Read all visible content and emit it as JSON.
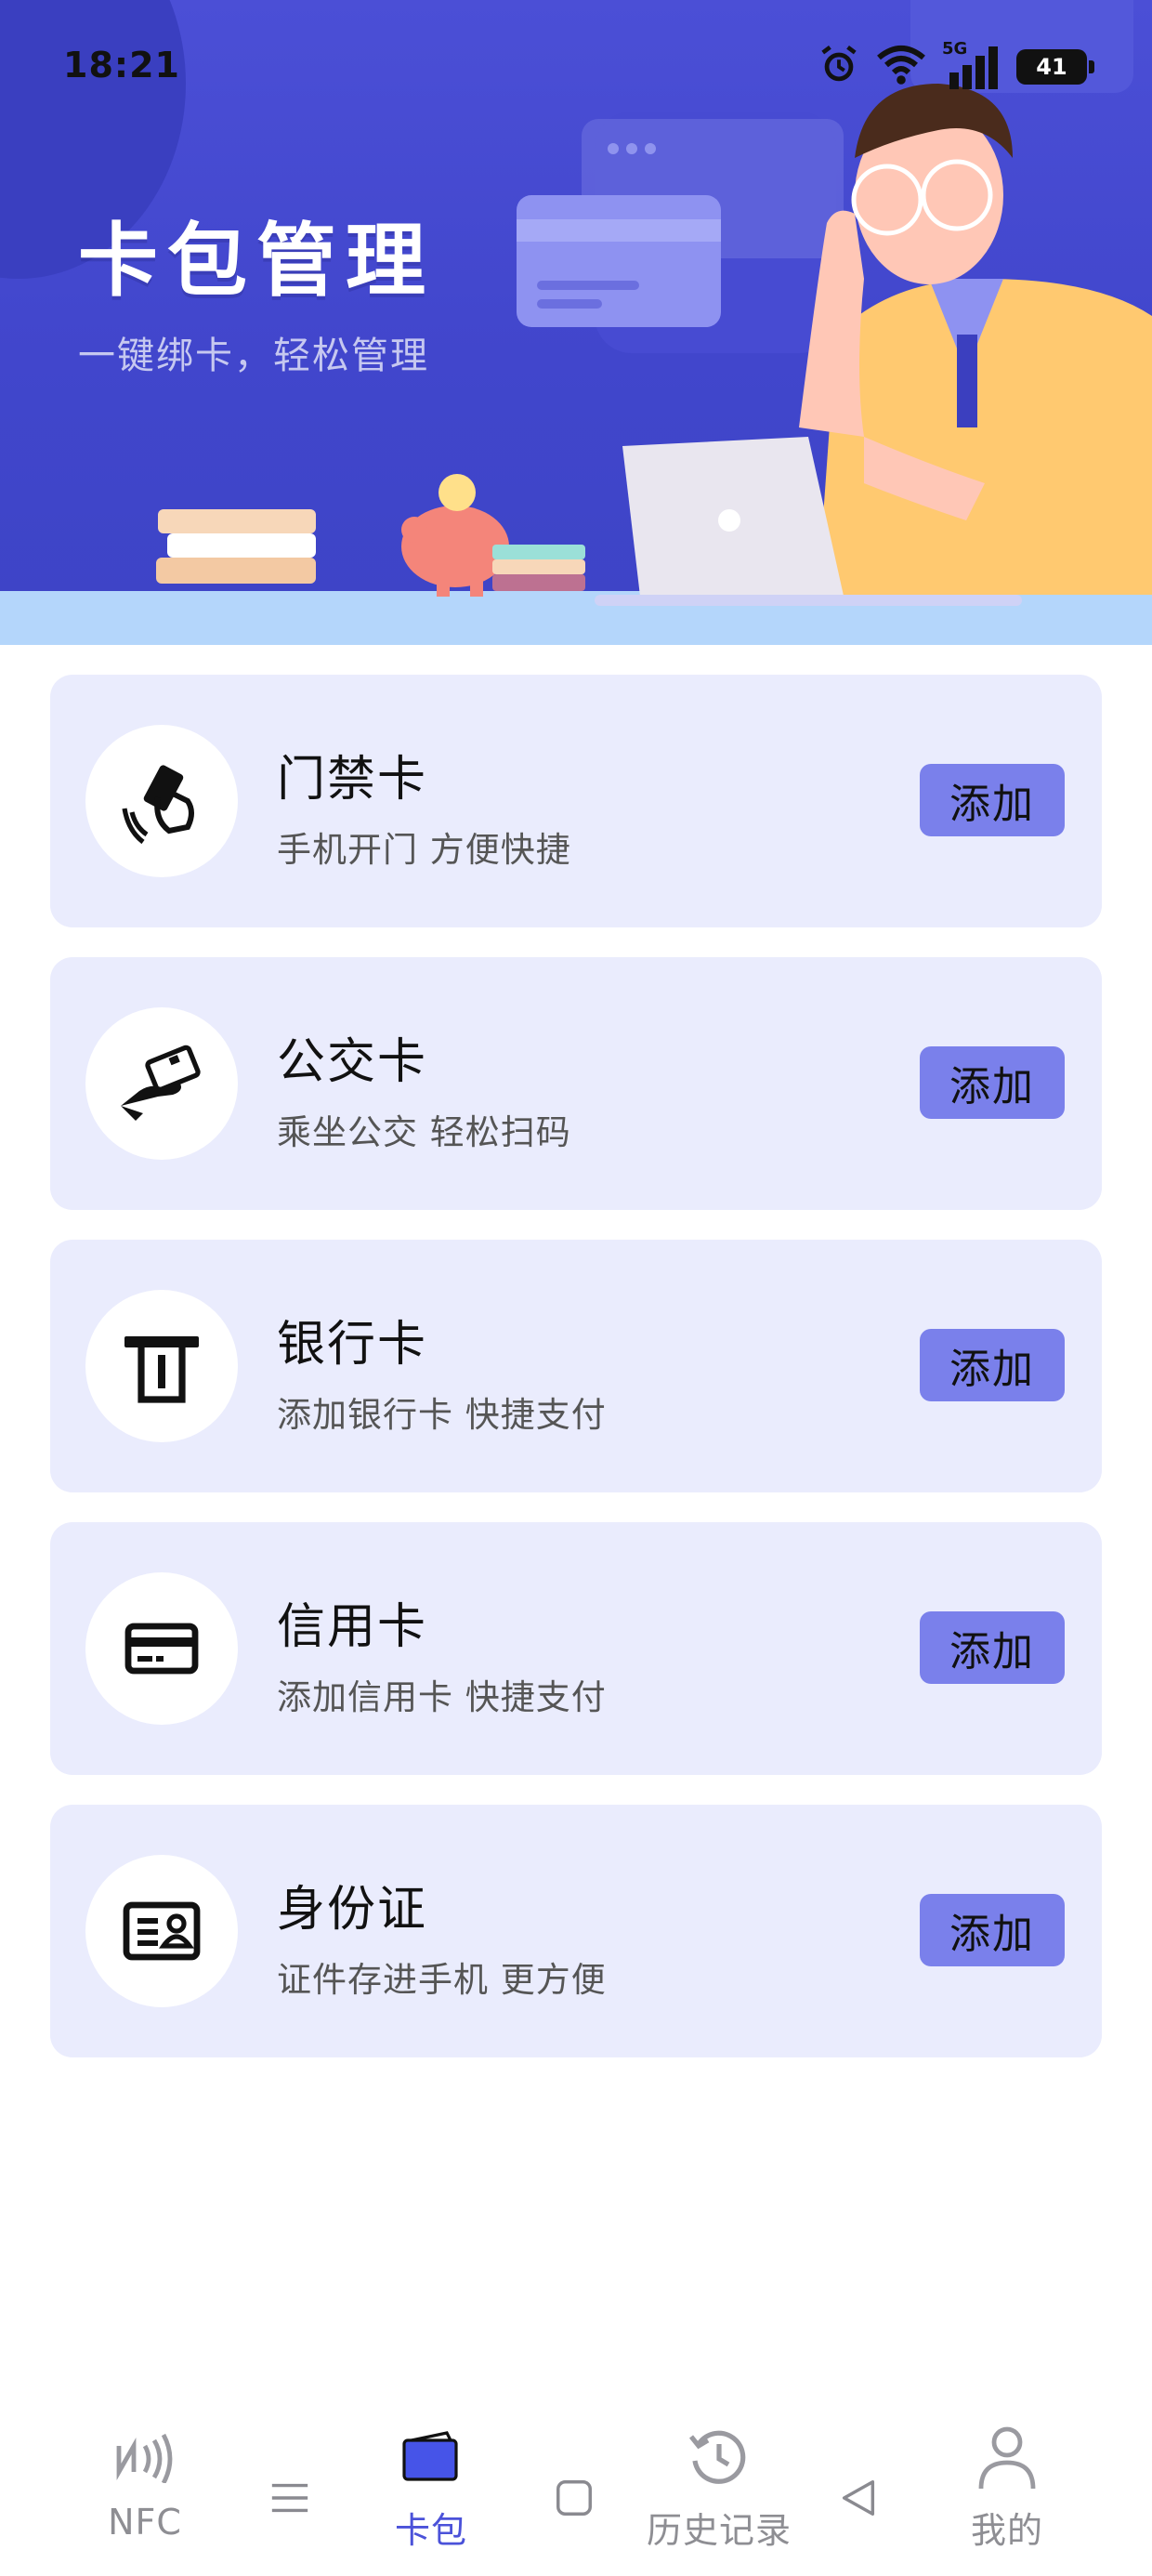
{
  "status_bar": {
    "time": "18:21",
    "network": "5G",
    "battery": "41"
  },
  "banner": {
    "title": "卡包管理",
    "subtitle": "一键绑卡，轻松管理"
  },
  "cards": [
    {
      "title": "门禁卡",
      "desc": "手机开门 方便快捷",
      "button": "添加",
      "icon": "tap-card-icon"
    },
    {
      "title": "公交卡",
      "desc": "乘坐公交 轻松扫码",
      "button": "添加",
      "icon": "hand-card-icon"
    },
    {
      "title": "银行卡",
      "desc": "添加银行卡 快捷支付",
      "button": "添加",
      "icon": "atm-card-icon"
    },
    {
      "title": "信用卡",
      "desc": "添加信用卡 快捷支付",
      "button": "添加",
      "icon": "credit-card-icon"
    },
    {
      "title": "身份证",
      "desc": "证件存进手机 更方便",
      "button": "添加",
      "icon": "id-card-icon"
    }
  ],
  "tabs": [
    {
      "label": "NFC",
      "icon": "nfc-icon"
    },
    {
      "label": "卡包",
      "icon": "wallet-icon",
      "active": true
    },
    {
      "label": "历史记录",
      "icon": "history-icon"
    },
    {
      "label": "我的",
      "icon": "profile-icon"
    }
  ],
  "colors": {
    "banner_blue": "#4146cc",
    "card_bg": "#eaecfd",
    "button_bg": "#7a80eb",
    "active_tab": "#4b52d9",
    "inactive_tab": "#8e8e93"
  }
}
